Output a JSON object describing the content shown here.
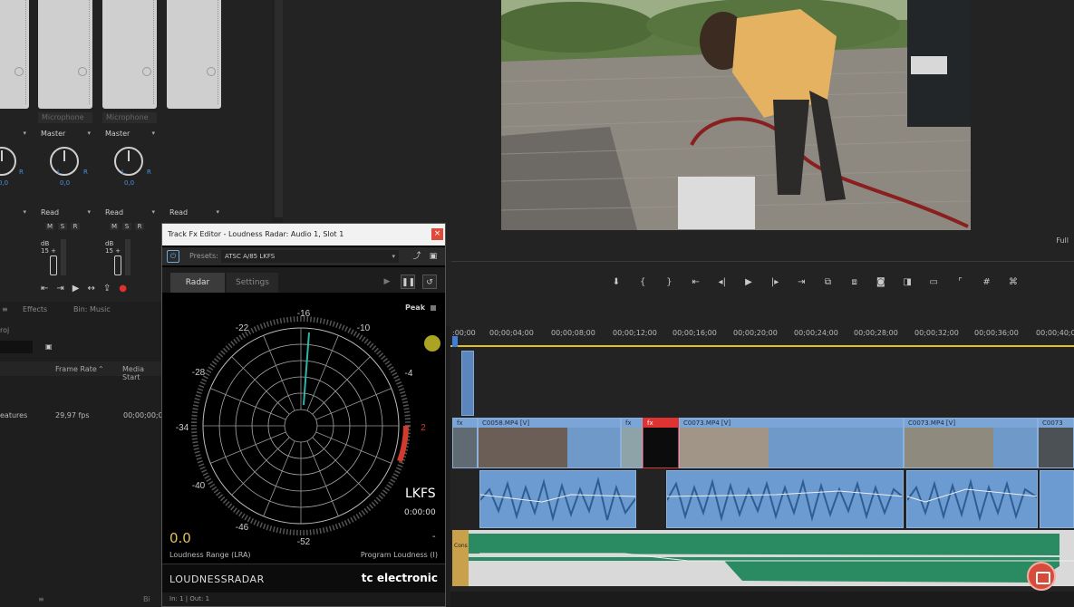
{
  "mixer": {
    "track_names": [
      "Microphone",
      "Microphone"
    ],
    "output_labels": [
      "Master",
      "Master"
    ],
    "pan_values": [
      "0,0",
      "0,0",
      "0,0"
    ],
    "pan_l": "L",
    "pan_r": "R",
    "automation_labels": [
      "Read",
      "Read",
      "Read"
    ],
    "msr": [
      "M",
      "S",
      "R"
    ],
    "db_label": "dB",
    "db_value": "15 +"
  },
  "project": {
    "tabs": [
      "Effects",
      "Bin: Music"
    ],
    "name_partial": "roj",
    "columns": [
      "Frame Rate",
      "Media Start"
    ],
    "row": {
      "name": "eatures",
      "fps": "29,97 fps",
      "start": "00;00;00;00"
    }
  },
  "monitor": {
    "fit": "Full",
    "controls_icons": [
      "marker-icon",
      "in-icon",
      "out-icon",
      "go-to-in-icon",
      "step-back-icon",
      "play-icon",
      "step-forward-icon",
      "go-to-out-icon",
      "insert-icon",
      "overwrite-icon",
      "export-frame-icon",
      "compare-icon",
      "safe-margins-icon",
      "crop-icon",
      "grid-icon",
      "vr-icon"
    ]
  },
  "timeline": {
    "timecodes": [
      ":00;00",
      "00;00;04;00",
      "00;00;08;00",
      "00;00;12;00",
      "00;00;16;00",
      "00;00;20;00",
      "00;00;24;00",
      "00;00;28;00",
      "00;00;32;00",
      "00;00;36;00",
      "00;00;40;00"
    ],
    "video_clips": [
      {
        "label": "fx"
      },
      {
        "label": "C0058.MP4 [V]"
      },
      {
        "label": "fx"
      },
      {
        "label": "fx"
      },
      {
        "label": "C0073.MP4 [V]"
      },
      {
        "label": "C0073.MP4 [V]"
      },
      {
        "label": "C0073"
      }
    ],
    "music_label": "Cons"
  },
  "fx_editor": {
    "title": "Track Fx Editor - Loudness Radar: Audio 1, Slot 1",
    "close": "×",
    "presets_label": "Presets:",
    "preset_value": "ATSC A/85 LKFS",
    "tabs": [
      "Radar",
      "Settings"
    ],
    "radar_labels": [
      "-16",
      "-10",
      "-4",
      "2",
      "-52",
      "-46",
      "-40",
      "-34",
      "-28",
      "-22"
    ],
    "peak": "Peak",
    "unit": "LKFS",
    "time": "0:00:00",
    "lra_value": "0.0",
    "program_value": "-",
    "lra_label": "Loudness Range (LRA)",
    "program_label": "Program Loudness (I)",
    "brand_left": "LOUDNESSRADAR",
    "brand_right": "tc electronic",
    "status": "In: 1 | Out: 1",
    "colors": {
      "accent": "#2fb5a8",
      "warning": "#d13b2e",
      "lra": "#e2c05a"
    }
  }
}
